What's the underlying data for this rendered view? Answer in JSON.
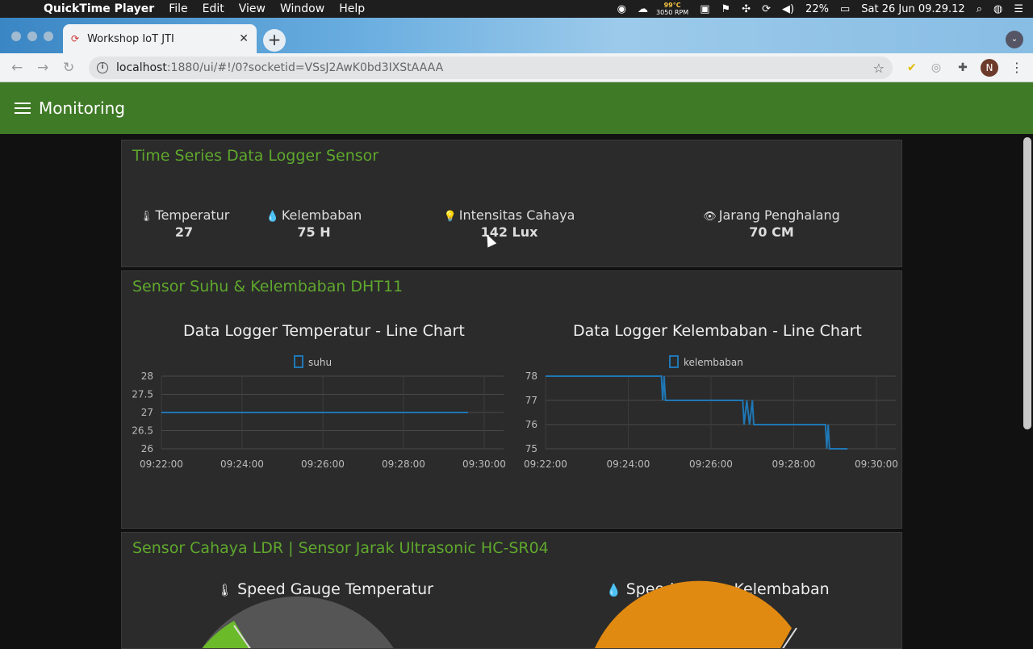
{
  "menubar": {
    "app": "QuickTime Player",
    "items": [
      "File",
      "Edit",
      "View",
      "Window",
      "Help"
    ],
    "cpu_temp": "99°C",
    "fan": "3050 RPM",
    "battery": "22%",
    "clock": "Sat 26 Jun  09.29.12"
  },
  "browser": {
    "tab_title": "Workshop IoT JTI",
    "url_host": "localhost",
    "url_path": ":1880/ui/#!/0?socketid=VSsJ2AwK0bd3IXStAAAA",
    "avatar": "N"
  },
  "dashboard": {
    "title": "Monitoring",
    "cards": {
      "logger": {
        "title": "Time Series Data Logger Sensor",
        "metrics": [
          {
            "label": "Temperatur",
            "value": "27",
            "icon": "thermometer-icon"
          },
          {
            "label": "Kelembaban",
            "value": "75 H",
            "icon": "droplet-icon"
          },
          {
            "label": "Intensitas Cahaya",
            "value": "142 Lux",
            "icon": "bulb-icon"
          },
          {
            "label": "Jarang Penghalang",
            "value": "70 CM",
            "icon": "eye-slash-icon"
          }
        ]
      },
      "dht": {
        "title": "Sensor Suhu & Kelembaban DHT11",
        "chart1_title": "Data Logger Temperatur - Line Chart",
        "chart2_title": "Data Logger Kelembaban - Line Chart"
      },
      "ldr": {
        "title": "Sensor Cahaya LDR | Sensor Jarak Ultrasonic HC-SR04",
        "gauge1_title": "Speed Gauge Temperatur",
        "gauge2_title": "Speed Gauge Kelembaban"
      }
    }
  },
  "chart_data": [
    {
      "type": "line",
      "title": "Data Logger Temperatur - Line Chart",
      "series": [
        {
          "name": "suhu",
          "color": "#1f77b4",
          "points": [
            [
              "09:22:00",
              27
            ],
            [
              "09:29:36",
              27
            ]
          ]
        }
      ],
      "x_ticks": [
        "09:22:00",
        "09:24:00",
        "09:26:00",
        "09:28:00",
        "09:30:00"
      ],
      "y_ticks": [
        "28",
        "27.5",
        "27",
        "26.5",
        "26"
      ],
      "xlim": [
        "09:22:00",
        "09:30:00"
      ],
      "ylim": [
        26,
        28
      ],
      "grid": true,
      "legend": "top"
    },
    {
      "type": "line",
      "title": "Data Logger Kelembaban - Line Chart",
      "series": [
        {
          "name": "kelembaban",
          "color": "#1f77b4",
          "points": [
            [
              "09:22:00",
              78
            ],
            [
              "09:24:48",
              78
            ],
            [
              "09:24:50",
              77
            ],
            [
              "09:24:52",
              78
            ],
            [
              "09:24:54",
              77
            ],
            [
              "09:26:46",
              77
            ],
            [
              "09:26:48",
              76
            ],
            [
              "09:26:52",
              77
            ],
            [
              "09:26:56",
              76
            ],
            [
              "09:27:00",
              77
            ],
            [
              "09:27:02",
              76
            ],
            [
              "09:28:46",
              76
            ],
            [
              "09:28:48",
              75
            ],
            [
              "09:28:50",
              76
            ],
            [
              "09:28:52",
              75
            ],
            [
              "09:29:18",
              75
            ]
          ]
        }
      ],
      "x_ticks": [
        "09:22:00",
        "09:24:00",
        "09:26:00",
        "09:28:00",
        "09:30:00"
      ],
      "y_ticks": [
        "78",
        "77",
        "76",
        "75"
      ],
      "xlim": [
        "09:22:00",
        "09:30:00"
      ],
      "ylim": [
        75,
        78
      ],
      "grid": true,
      "legend": "top"
    }
  ],
  "gauges": [
    {
      "title": "Speed Gauge Temperatur",
      "fill_color": "#6aba2a",
      "track_color": "#555555"
    },
    {
      "title": "Speed Gauge Kelembaban",
      "fill_color": "#e08a12",
      "track_color": "#555555"
    }
  ]
}
